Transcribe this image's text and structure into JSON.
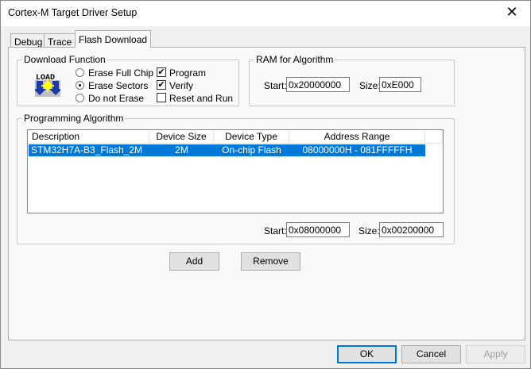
{
  "window": {
    "title": "Cortex-M Target Driver Setup",
    "close": "✕"
  },
  "tabs": [
    {
      "label": "Debug"
    },
    {
      "label": "Trace"
    },
    {
      "label": "Flash Download"
    }
  ],
  "download_function": {
    "legend": "Download Function",
    "logo": "LOAD",
    "radios": [
      {
        "label": "Erase Full Chip",
        "checked": false
      },
      {
        "label": "Erase Sectors",
        "checked": true
      },
      {
        "label": "Do not Erase",
        "checked": false
      }
    ],
    "checks": [
      {
        "label": "Program",
        "checked": true
      },
      {
        "label": "Verify",
        "checked": true
      },
      {
        "label": "Reset and Run",
        "checked": false
      }
    ]
  },
  "ram": {
    "legend": "RAM for Algorithm",
    "start_label": "Start:",
    "start": "0x20000000",
    "size_label": "Size:",
    "size": "0xE000"
  },
  "algorithm": {
    "legend": "Programming Algorithm",
    "columns": [
      "Description",
      "Device Size",
      "Device Type",
      "Address Range"
    ],
    "rows": [
      [
        "STM32H7A-B3_Flash_2M",
        "2M",
        "On-chip Flash",
        "08000000H - 081FFFFFH"
      ]
    ],
    "start_label": "Start:",
    "start": "0x08000000",
    "size_label": "Size:",
    "size": "0x00200000"
  },
  "buttons": {
    "add": "Add",
    "remove": "Remove",
    "ok": "OK",
    "cancel": "Cancel",
    "apply": "Apply"
  }
}
